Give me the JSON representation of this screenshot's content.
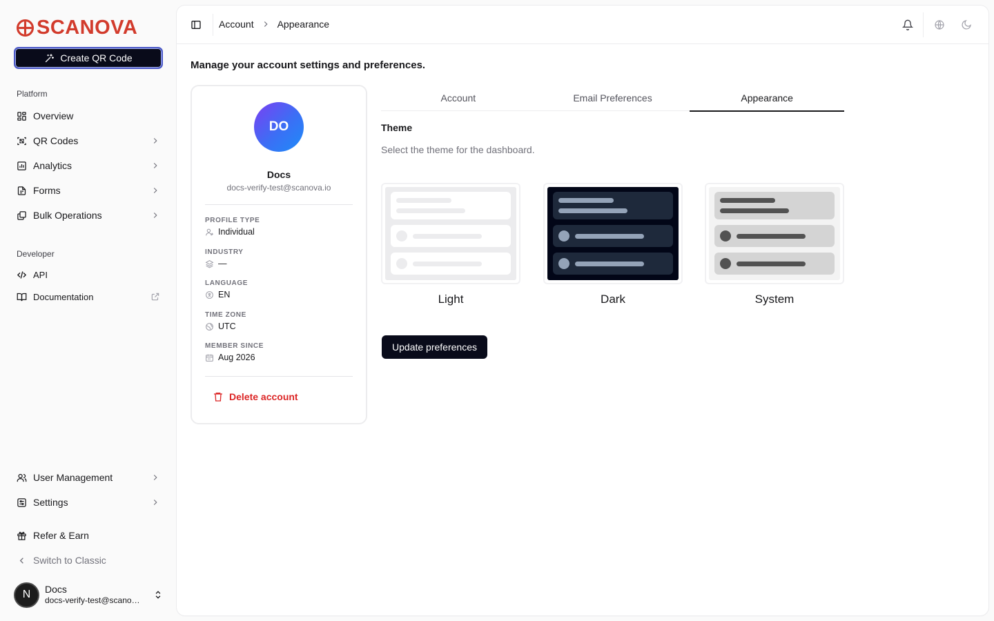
{
  "brand": {
    "name": "SCANOVA",
    "color": "#d23b2c"
  },
  "sidebar": {
    "create_label": "Create QR Code",
    "platform_label": "Platform",
    "platform_items": [
      {
        "label": "Overview",
        "icon": "grid-icon"
      },
      {
        "label": "QR Codes",
        "icon": "qr-scan-icon"
      },
      {
        "label": "Analytics",
        "icon": "chart-icon"
      },
      {
        "label": "Forms",
        "icon": "form-icon"
      },
      {
        "label": "Bulk Operations",
        "icon": "layers-icon"
      }
    ],
    "developer_label": "Developer",
    "developer_items": [
      {
        "label": "API",
        "icon": "code-icon"
      },
      {
        "label": "Documentation",
        "icon": "book-icon"
      }
    ],
    "bottom_items": [
      {
        "label": "User Management",
        "icon": "users-icon"
      },
      {
        "label": "Settings",
        "icon": "settings-icon"
      },
      {
        "label": "Refer & Earn",
        "icon": "gift-icon"
      },
      {
        "label": "Switch to Classic",
        "icon": "chevron-left-icon"
      }
    ],
    "user": {
      "initial": "N",
      "name": "Docs",
      "email": "docs-verify-test@scanova.io"
    }
  },
  "topbar": {
    "breadcrumb": [
      "Account",
      "Appearance"
    ]
  },
  "page": {
    "heading": "Manage your account settings and preferences."
  },
  "profile": {
    "initials": "DO",
    "name": "Docs",
    "email": "docs-verify-test@scanova.io",
    "fields": [
      {
        "label": "PROFILE TYPE",
        "value": "Individual",
        "icon": "user-icon"
      },
      {
        "label": "INDUSTRY",
        "value": "—",
        "icon": "layers-icon"
      },
      {
        "label": "LANGUAGE",
        "value": "EN",
        "icon": "language-icon"
      },
      {
        "label": "TIME ZONE",
        "value": "UTC",
        "icon": "globe-icon"
      },
      {
        "label": "MEMBER SINCE",
        "value": "Aug 2026",
        "icon": "calendar-icon"
      }
    ],
    "delete_label": "Delete account"
  },
  "tabs": [
    {
      "label": "Account",
      "active": false
    },
    {
      "label": "Email Preferences",
      "active": false
    },
    {
      "label": "Appearance",
      "active": true
    }
  ],
  "appearance": {
    "title": "Theme",
    "subtitle": "Select the theme for the dashboard.",
    "options": [
      {
        "label": "Light",
        "selected": false
      },
      {
        "label": "Dark",
        "selected": false
      },
      {
        "label": "System",
        "selected": false
      }
    ],
    "update_label": "Update preferences"
  }
}
